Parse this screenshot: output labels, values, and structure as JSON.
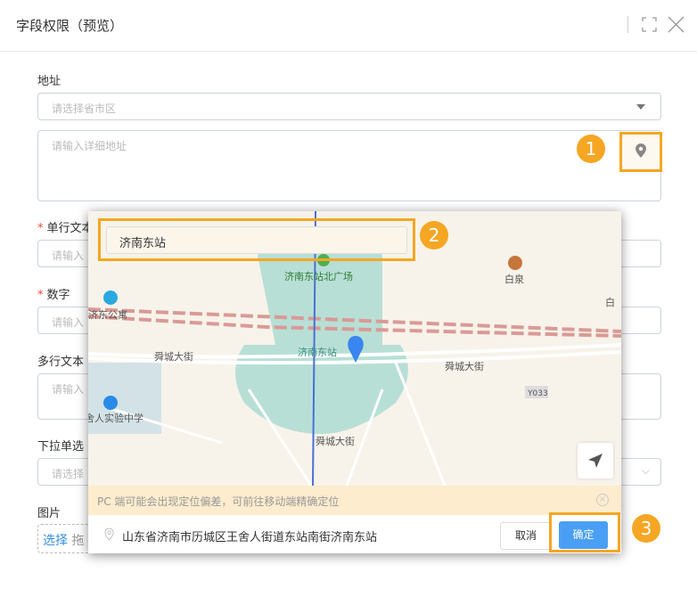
{
  "dialog": {
    "title": "字段权限（预览）",
    "icons": [
      "fullscreen-icon",
      "close-icon"
    ]
  },
  "form": {
    "address_label": "地址",
    "region_placeholder": "请选择省市区",
    "detail_placeholder": "请输入详细地址",
    "single_text_label": "单行文本",
    "single_text_placeholder": "请输入",
    "number_label": "数字",
    "number_placeholder": "请输入",
    "multi_text_label": "多行文本",
    "multi_text_placeholder": "请输入",
    "dropdown_label": "下拉单选",
    "dropdown_placeholder": "请选择",
    "image_label": "图片",
    "image_select": "选择",
    "image_drag": "拖"
  },
  "badges": [
    "1",
    "2",
    "3"
  ],
  "accent": "#f5a623",
  "map_popup": {
    "search_value": "济南东站",
    "map_labels": {
      "north_plaza": "济南东站北广场",
      "station": "济南东站",
      "baiquan": "白泉",
      "baiquan2": "白",
      "apartment": "济东公寓",
      "street1": "舜城大街",
      "street2": "舜城大街",
      "street3": "舜城大街",
      "road_code": "Y033",
      "school": "舍人实验中学"
    },
    "warning": "PC 端可能会出现定位偏差，可前往移动端精确定位",
    "selected_address": "山东省济南市历城区王舍人街道东站南街济南东站",
    "cancel": "取消",
    "confirm": "确定",
    "confirm_color": "#4a9ff5"
  }
}
